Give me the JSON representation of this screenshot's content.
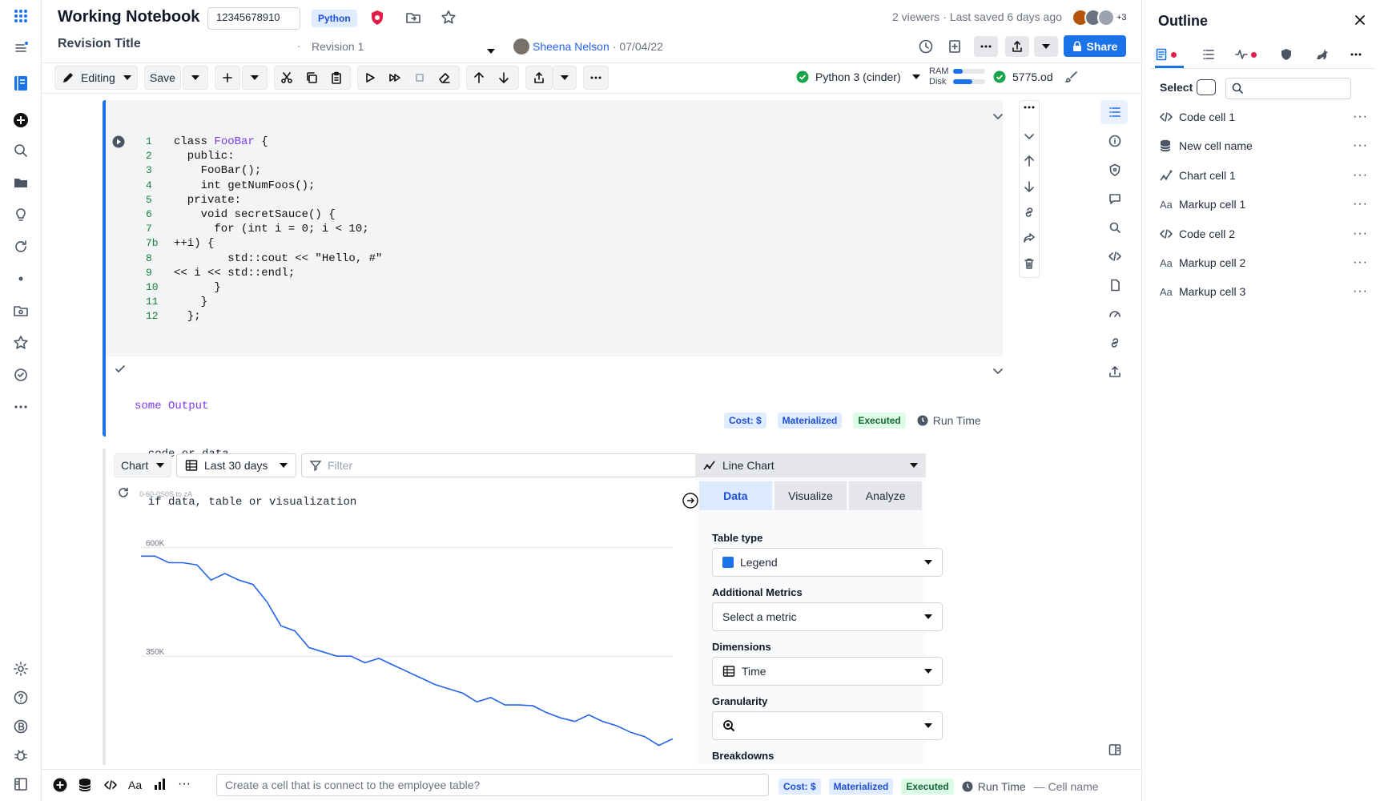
{
  "notebook": {
    "title": "Working Notebook",
    "id_value": "12345678910",
    "language_tag": "Python",
    "viewers": "2 viewers",
    "last_saved": "Last saved 6 days ago",
    "avatar_extra": "+3",
    "revision_title": "Revision Title",
    "revision_label": "Revision 1",
    "author": "Sheena Nelson",
    "date": "07/04/22",
    "share_label": "Share"
  },
  "toolbar": {
    "editing_label": "Editing",
    "save_label": "Save",
    "kernel_label": "Python 3 (cinder)",
    "ram_label": "RAM",
    "disk_label": "Disk",
    "ram_fraction": 0.3,
    "disk_fraction": 0.6,
    "compute_value": "5775.od"
  },
  "code_cell": {
    "lines": [
      {
        "n": "1",
        "text": "class FooBar {"
      },
      {
        "n": "2",
        "text": "  public:"
      },
      {
        "n": "3",
        "text": "    FooBar();"
      },
      {
        "n": "4",
        "text": "    int getNumFoos();"
      },
      {
        "n": "5",
        "text": "  private:"
      },
      {
        "n": "6",
        "text": "    void secretSauce() {"
      },
      {
        "n": "7",
        "text": "      for (int i = 0; i < 10;"
      },
      {
        "n": "7b",
        "text": "++i) {"
      },
      {
        "n": "8",
        "text": "        std::cout << \"Hello, #\""
      },
      {
        "n": "9",
        "text": "<< i << std::endl;"
      },
      {
        "n": "10",
        "text": "      }"
      },
      {
        "n": "11",
        "text": "    }"
      },
      {
        "n": "12",
        "text": "  };"
      }
    ],
    "output_lines": [
      "some Output",
      "  code or data",
      "  if data, table or visualization"
    ],
    "badges": {
      "cost": "Cost: $",
      "materialized": "Materialized",
      "executed": "Executed",
      "run_time": "Run Time"
    }
  },
  "chart_cell": {
    "type_dropdown": "Chart",
    "date_range": "Last 30 days",
    "filter_placeholder": "Filter",
    "chart_caption": "0-60-0S0S to zA",
    "panel": {
      "chart_type": "Line Chart",
      "tabs": [
        "Data",
        "Visualize",
        "Analyze"
      ],
      "active_tab": "Data",
      "table_type_label": "Table type",
      "table_type_value": "Legend",
      "additional_metrics_label": "Additional Metrics",
      "additional_metrics_value": "Select a metric",
      "dimensions_label": "Dimensions",
      "dimensions_value": "Time",
      "granularity_label": "Granularity",
      "granularity_value": "",
      "breakdowns_label": "Breakdowns"
    }
  },
  "chart_data": {
    "type": "line",
    "title": "",
    "xlabel": "",
    "ylabel": "",
    "y_ticks": [
      {
        "label": "600K",
        "value": 600000
      },
      {
        "label": "350K",
        "value": 350000
      }
    ],
    "ylim": [
      100000,
      680000
    ],
    "series": [
      {
        "color": "#2563eb",
        "x": [
          0,
          1,
          2,
          3,
          4,
          5,
          6,
          7,
          8,
          9,
          10,
          11,
          12,
          13,
          14,
          15,
          16,
          17,
          18,
          19,
          20,
          21,
          22,
          23,
          24,
          25,
          26,
          27,
          28,
          29,
          30,
          31,
          32,
          33,
          34,
          35,
          36,
          37,
          38
        ],
        "values": [
          580000,
          580000,
          565000,
          565000,
          560000,
          525000,
          540000,
          525000,
          515000,
          475000,
          420000,
          408000,
          370000,
          360000,
          350000,
          350000,
          335000,
          345000,
          330000,
          315000,
          300000,
          285000,
          275000,
          265000,
          245000,
          255000,
          238000,
          238000,
          236000,
          220000,
          208000,
          200000,
          215000,
          200000,
          190000,
          175000,
          165000,
          145000,
          160000
        ]
      }
    ]
  },
  "outline": {
    "title": "Outline",
    "select_label": "Select",
    "items": [
      {
        "icon": "code",
        "label": "Code cell 1"
      },
      {
        "icon": "database",
        "label": "New cell name"
      },
      {
        "icon": "chart",
        "label": "Chart cell 1"
      },
      {
        "icon": "markup",
        "label": "Markup cell 1"
      },
      {
        "icon": "code",
        "label": "Code cell 2"
      },
      {
        "icon": "markup",
        "label": "Markup cell 2"
      },
      {
        "icon": "markup",
        "label": "Markup cell 3"
      }
    ],
    "markup_glyph": "Aa",
    "more_glyph": "···"
  },
  "bottom_bar": {
    "markup_glyph": "Aa",
    "more_glyph": "···",
    "input_placeholder": "Create a cell that is connect to the employee table?",
    "cost": "Cost: $",
    "materialized": "Materialized",
    "executed": "Executed",
    "run_time": "Run Time",
    "cell_name": "— Cell name"
  },
  "colors": {
    "accent": "#1a73e8",
    "success": "#16a34a",
    "alert": "#e11d48"
  }
}
